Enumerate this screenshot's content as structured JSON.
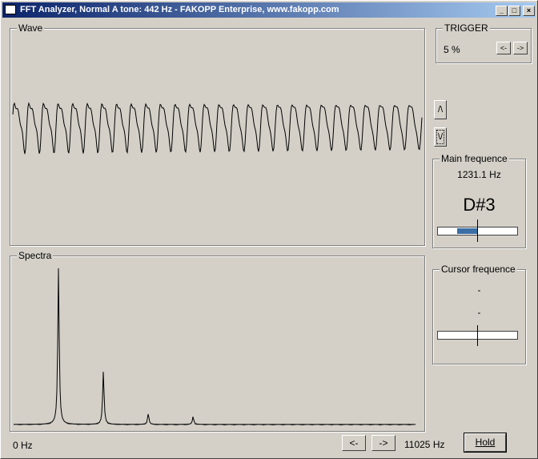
{
  "window": {
    "title": "FFT Analyzer, Normal A tone: 442 Hz - FAKOPP Enterprise, www.fakopp.com",
    "minimize_label": "_",
    "maximize_label": "□",
    "close_label": "×"
  },
  "wave": {
    "label": "Wave"
  },
  "spectra": {
    "label": "Spectra"
  },
  "trigger": {
    "label": "TRIGGER",
    "value": "5 %",
    "left_label": "<-",
    "right_label": "->"
  },
  "edge_buttons": {
    "rising_label": "/\\",
    "falling_label": "\\/"
  },
  "main_frequence": {
    "label": "Main frequence",
    "value": "1231.1 Hz",
    "note": "D#3",
    "tuning_offset": -0.25
  },
  "cursor_frequence": {
    "label": "Cursor frequence",
    "value": "-",
    "note": "-"
  },
  "bottom": {
    "min_freq": "0 Hz",
    "max_freq": "11025 Hz",
    "left_label": "<-",
    "right_label": "->",
    "hold_label": "Hold"
  },
  "colors": {
    "accent": "#3a6ea5",
    "title_start": "#0a246a",
    "title_end": "#a6caf0"
  },
  "chart_data": {
    "type": "line",
    "spectrum_peaks_hz": [
      1231,
      2462,
      3693,
      4924
    ],
    "spectrum_peak_levels": [
      1.0,
      0.34,
      0.07,
      0.05
    ],
    "x_range_hz": [
      0,
      11025
    ]
  }
}
